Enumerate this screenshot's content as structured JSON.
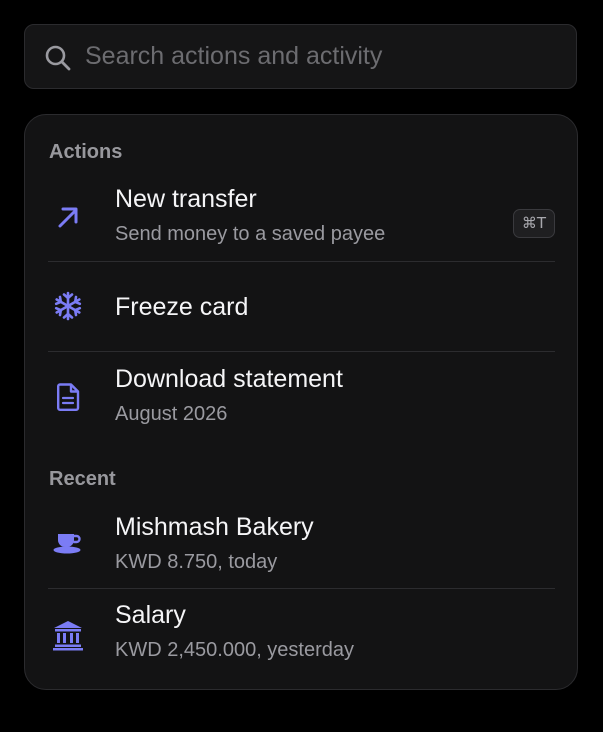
{
  "search": {
    "placeholder": "Search actions and activity",
    "value": ""
  },
  "sections": {
    "actions_label": "Actions",
    "recent_label": "Recent"
  },
  "actions": [
    {
      "title": "New transfer",
      "subtitle": "Send money to a saved payee",
      "shortcut": "⌘T",
      "icon": "arrow-up-right-icon"
    },
    {
      "title": "Freeze card",
      "icon": "snowflake-icon"
    },
    {
      "title": "Download statement",
      "subtitle": "August 2026",
      "icon": "document-icon"
    }
  ],
  "recent": [
    {
      "title": "Mishmash Bakery",
      "subtitle": "KWD 8.750, today",
      "icon": "coffee-cup-icon"
    },
    {
      "title": "Salary",
      "subtitle": "KWD 2,450.000, yesterday",
      "icon": "bank-icon"
    }
  ],
  "colors": {
    "background": "#000000",
    "panel": "#131314",
    "accent": "#7b7cf5",
    "text_primary": "#f5f5f7",
    "text_secondary": "#9a9aa0"
  }
}
